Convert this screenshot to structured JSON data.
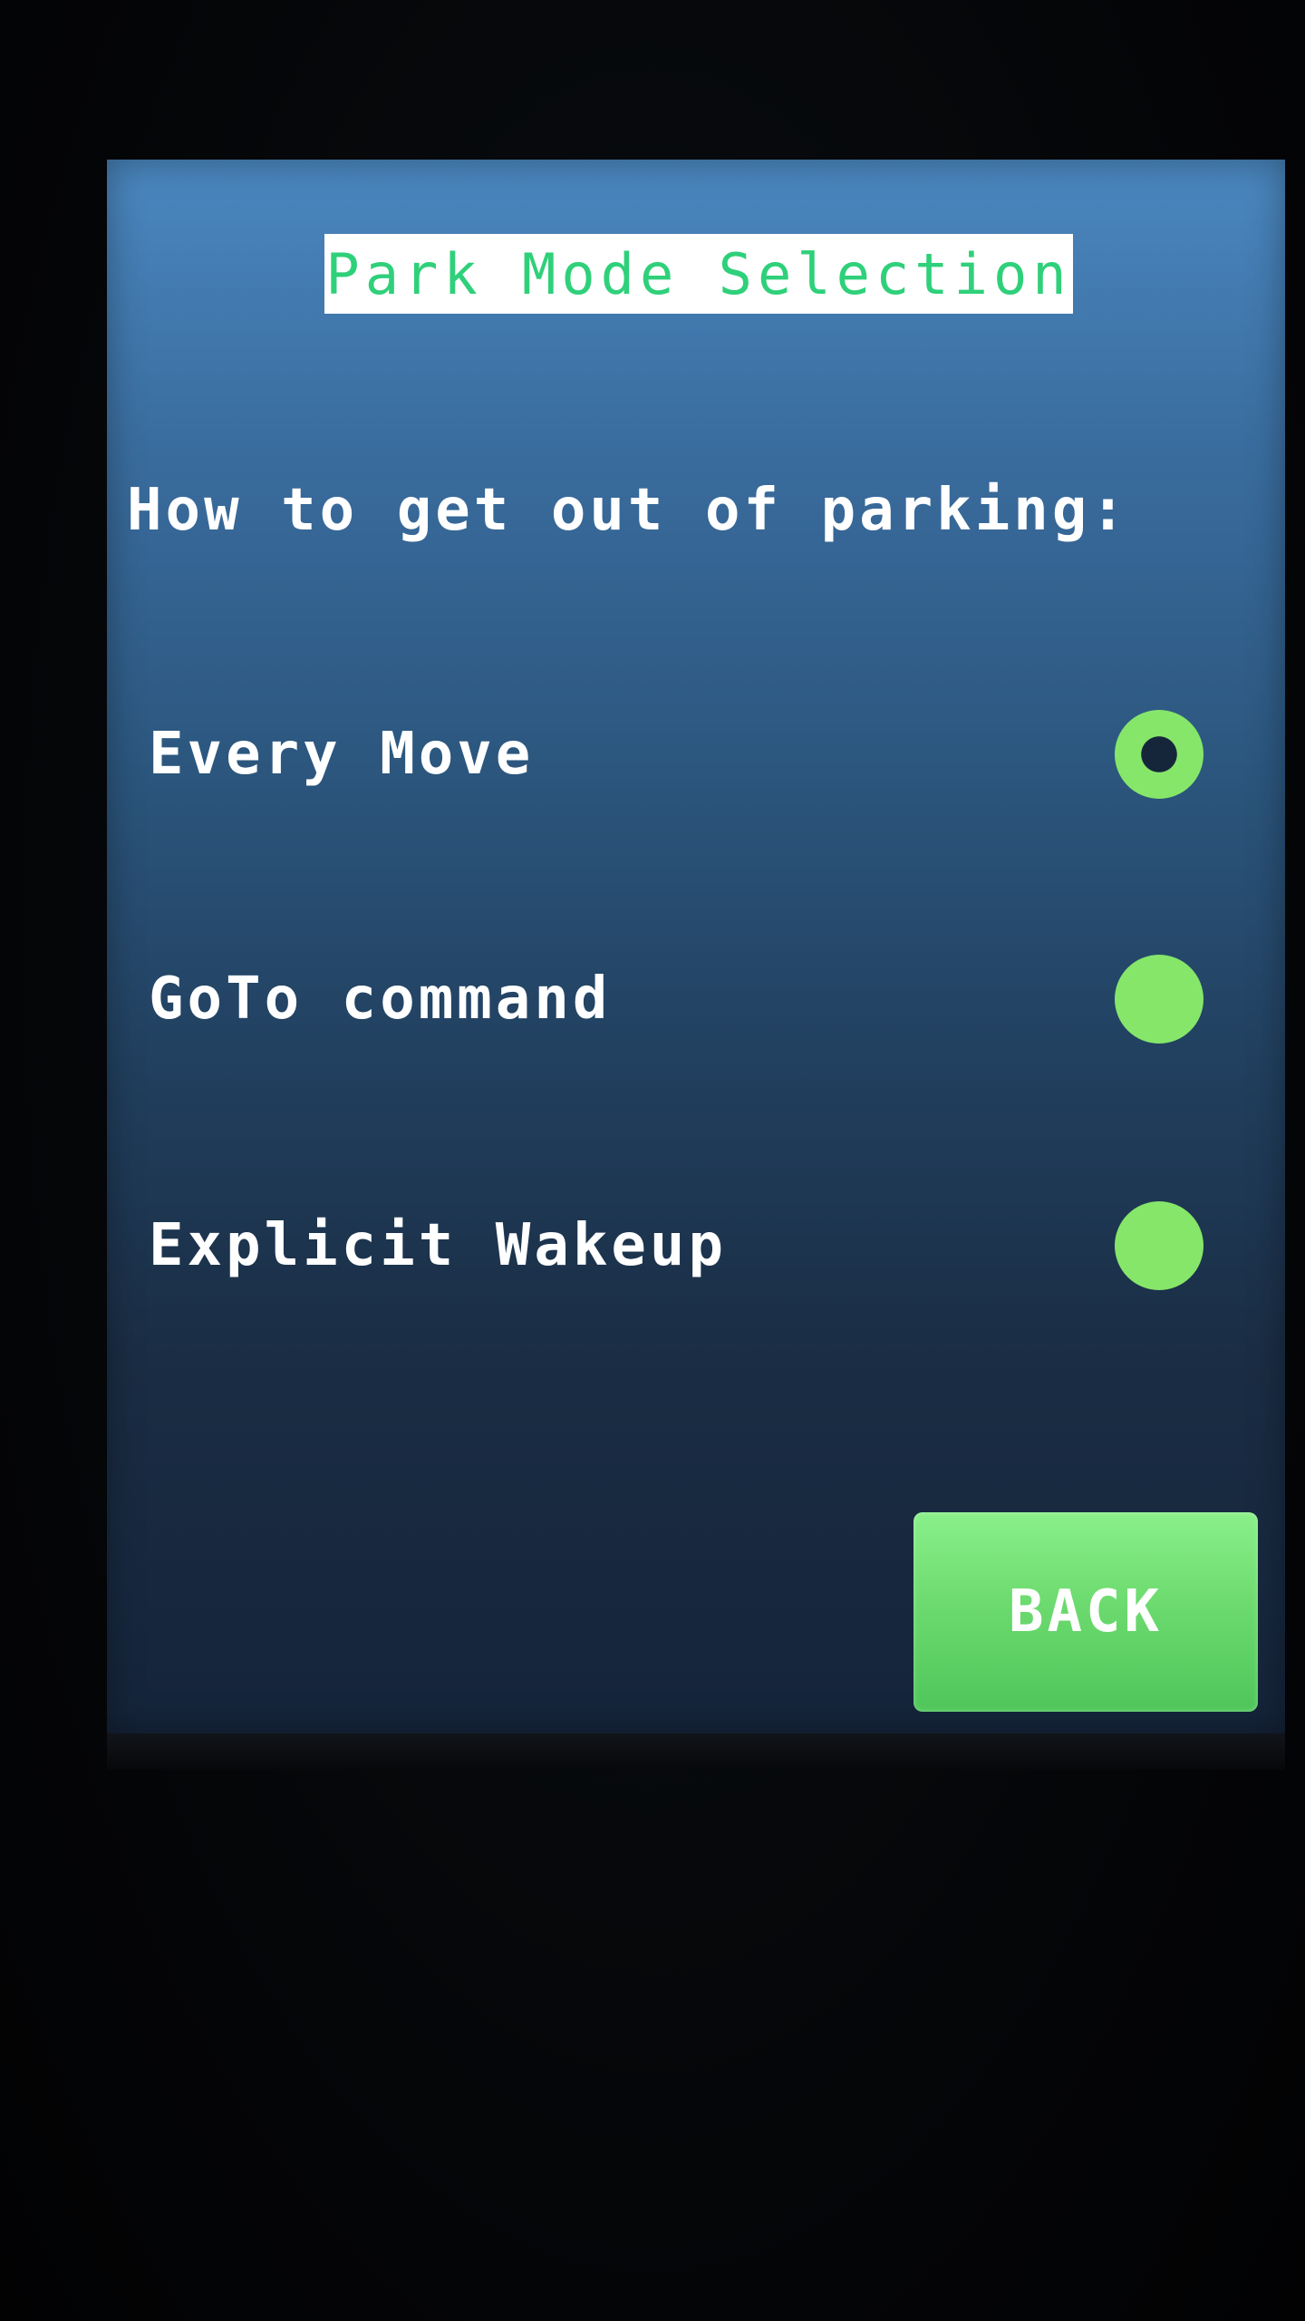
{
  "title": "Park Mode Selection",
  "prompt": "How to get out of parking:",
  "options": [
    {
      "label": "Every Move",
      "selected": true
    },
    {
      "label": "GoTo command",
      "selected": false
    },
    {
      "label": "Explicit Wakeup",
      "selected": false
    }
  ],
  "back_button": {
    "label": "BACK"
  },
  "colors": {
    "accent_green": "#86e66a",
    "title_text": "#2fd07a",
    "screen_top": "#4a87bf",
    "screen_bottom": "#15243a"
  }
}
